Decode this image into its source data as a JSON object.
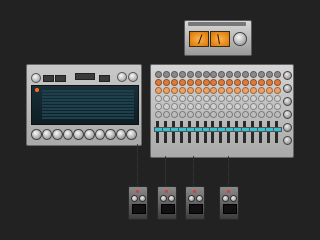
{
  "output_unit": {
    "name": "vu-output",
    "meters": 2
  },
  "synth": {
    "screen_rows": 10,
    "bottom_knobs": 10
  },
  "mixer": {
    "channels": 16,
    "knob_colors": [
      "#8a8a8a",
      "#e07a3a",
      "#f0a060",
      "#d0d0d0",
      "#d0d0d0",
      "#bdbdbd"
    ],
    "knob_counts": {
      "per_strip": 6
    },
    "fader_color": "#34c3d2",
    "master_knobs": 6
  },
  "pedals": {
    "count": 4,
    "led_color": "#e23a2a"
  },
  "colors": {
    "background": "#222222",
    "vu_amber": "#f08a1a",
    "accent_teal": "#34c3d2",
    "synth_screen": "#0f2a33"
  }
}
